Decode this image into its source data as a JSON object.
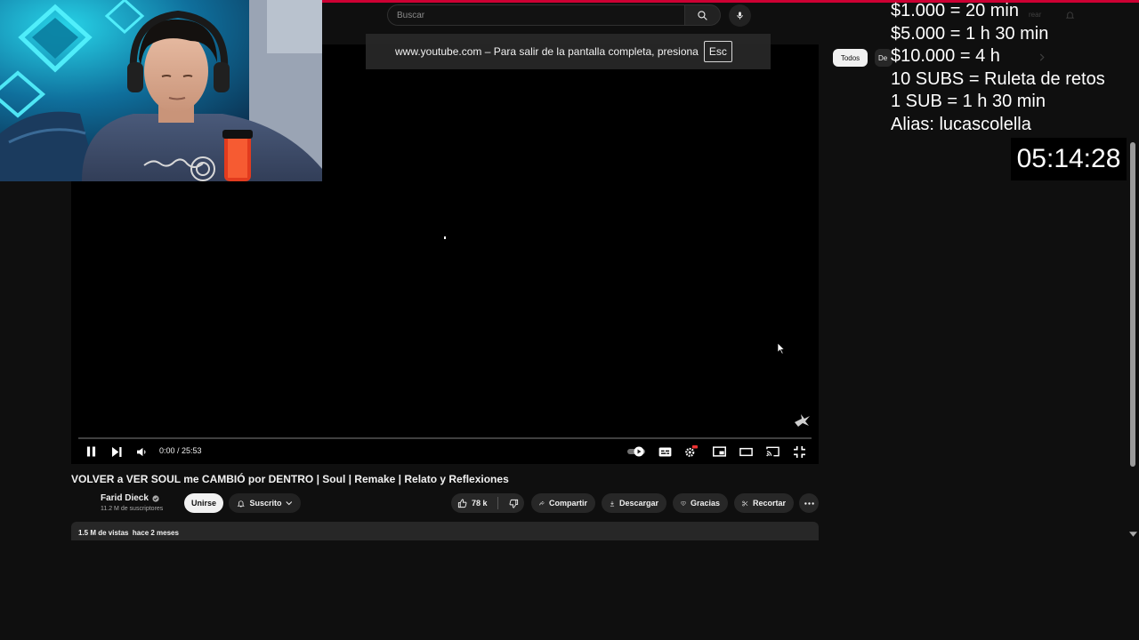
{
  "search": {
    "placeholder": "Buscar"
  },
  "fullscreen_banner": {
    "text": "www.youtube.com – Para salir de la pantalla completa, presiona",
    "key": "Esc"
  },
  "player": {
    "time": "0:00 / 25:53",
    "progress_fraction": 0.0
  },
  "video": {
    "title": "VOLVER a VER SOUL me CAMBIÓ por DENTRO | Soul | Remake | Relato y Reflexiones"
  },
  "channel": {
    "name": "Farid Dieck",
    "subscribers": "11.2 M de suscriptores"
  },
  "actions": {
    "join": "Unirse",
    "subscribed": "Suscrito",
    "likes": "78 k",
    "share": "Compartir",
    "download": "Descargar",
    "thanks": "Gracias",
    "clip": "Recortar"
  },
  "description": {
    "stats": "1.5 M de vistas  hace 2 meses"
  },
  "chips": [
    {
      "label": "Todos"
    },
    {
      "label": "De"
    }
  ],
  "faint": {
    "create": "rear"
  },
  "overlay": {
    "donations": [
      "$1.000 = 20 min",
      "$5.000 = 1 h 30 min",
      "$10.000 = 4 h",
      "10 SUBS =  Ruleta de retos",
      "1 SUB = 1 h 30 min",
      "Alias: lucascolella"
    ],
    "timer": "05:14:28"
  },
  "colors": {
    "accent": "#cc0033",
    "background": "#0f0f0f",
    "pill": "#272727"
  }
}
